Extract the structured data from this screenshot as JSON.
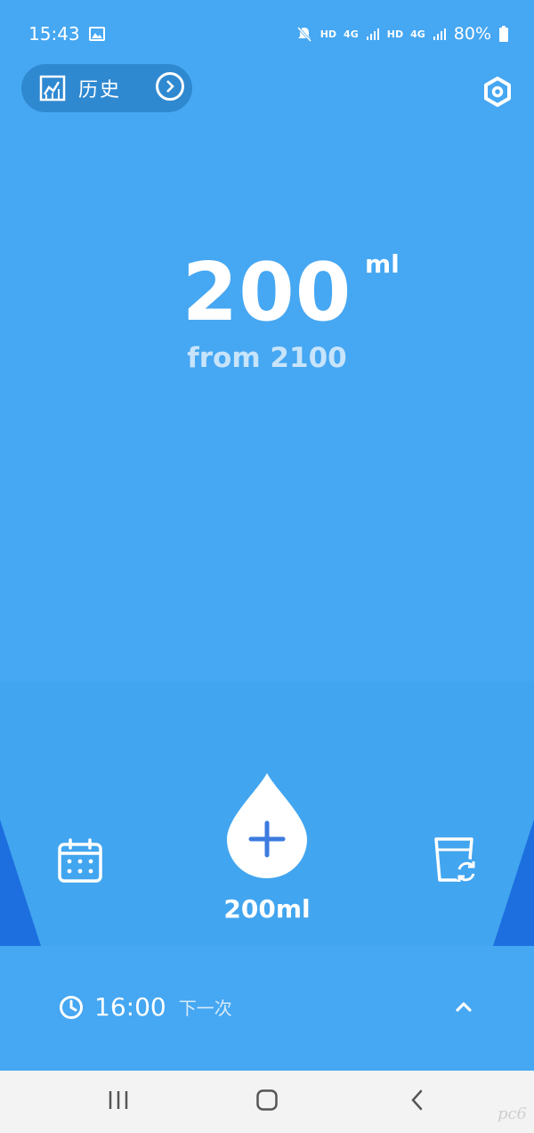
{
  "status_bar": {
    "time": "15:43",
    "hd1": "HD",
    "net1": "4G",
    "hd2": "HD",
    "net2": "4G",
    "battery": "80%",
    "icons": [
      "image-icon",
      "mute-icon",
      "signal-icon",
      "battery-icon"
    ]
  },
  "header": {
    "history_label": "历史",
    "icons": [
      "chart-icon",
      "arrow-right-icon",
      "settings-icon"
    ]
  },
  "main": {
    "amount": "200",
    "unit": "ml",
    "goal_text": "from 2100"
  },
  "actions": {
    "drop_label": "200ml",
    "icons": [
      "calendar-icon",
      "add-drop-icon",
      "cup-switch-icon"
    ]
  },
  "reminder": {
    "time": "16:00",
    "label": "下一次",
    "icons": [
      "clock-icon",
      "chevron-up-icon"
    ]
  },
  "nav": {
    "icons": [
      "recent-apps-icon",
      "home-icon",
      "back-icon"
    ]
  },
  "watermark": "pc6",
  "colors": {
    "background": "#46a7f2",
    "history_button": "#2f89d1",
    "accent_dark": "#1d6fe0",
    "plus": "#3c7bdf",
    "nav_bg": "#f3f3f3"
  }
}
